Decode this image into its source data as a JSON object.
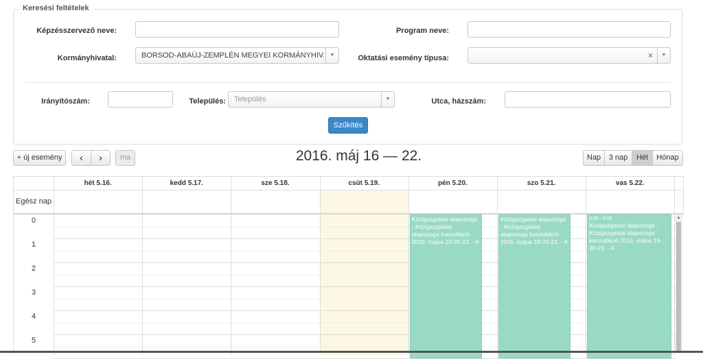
{
  "filters": {
    "legend": "Keresési feltételek",
    "organizer_label": "Képzésszervező neve:",
    "organizer_value": "",
    "program_label": "Program neve:",
    "program_value": "",
    "office_label": "Kormányhivatal:",
    "office_value": "BORSOD-ABAÚJ-ZEMPLÉN MEGYEI KORMÁNYHIV...",
    "event_type_label": "Oktatási esemény típusa:",
    "event_type_value": "",
    "zip_label": "Irányítószám:",
    "zip_value": "",
    "city_label": "Település:",
    "city_placeholder": "Település",
    "street_label": "Utca, házszám:",
    "street_value": "",
    "submit_label": "Szűkítés"
  },
  "toolbar": {
    "new_event_label": "+ új esemény",
    "prev_icon": "chevron-left-icon",
    "next_icon": "chevron-right-icon",
    "prev_glyph": "‹",
    "next_glyph": "›",
    "today_label": "ma",
    "title": "2016. máj 16 — 22.",
    "views": [
      "Nap",
      "3 nap",
      "Hét",
      "Hónap"
    ],
    "active_view": "Hét"
  },
  "calendar": {
    "days": [
      "hét 5.16.",
      "kedd 5.17.",
      "sze 5.18.",
      "csüt 5.19.",
      "pén 5.20.",
      "szo 5.21.",
      "vas 5.22."
    ],
    "today_index": 3,
    "allday_label": "Egész nap",
    "hours": [
      "0",
      "1",
      "2",
      "3",
      "4",
      "5"
    ],
    "events": [
      {
        "day": 4,
        "time": "",
        "text": "Közigazgatási alapvizsga - Közigazgatási alapvizsga konzultáció 2016. május 19-20-23. - A"
      },
      {
        "day": 5,
        "time": "",
        "text": "Közigazgatási alapvizsga - Közigazgatási alapvizsga konzultáció 2016. május 19-20-23. - A"
      },
      {
        "day": 6,
        "time": "0:00 - 0:00",
        "text": "Közigazgatási alapvizsga - Közigazgatási alapvizsga konzultáció 2016. május 19-20-23. - A"
      }
    ],
    "colors": {
      "event_bg": "#99dac6",
      "today_bg": "#fcf8e3",
      "primary": "#3b87c8"
    }
  }
}
